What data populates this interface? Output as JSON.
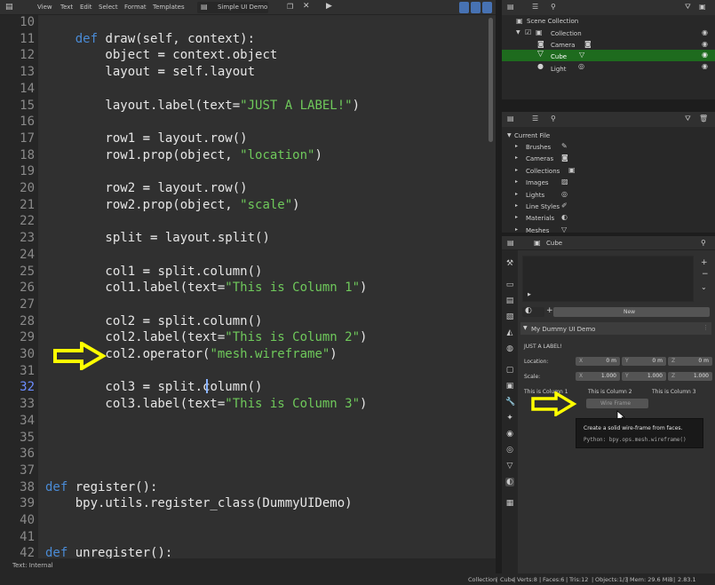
{
  "editor": {
    "menu": [
      "View",
      "Text",
      "Edit",
      "Select",
      "Format",
      "Templates"
    ],
    "file_name": "Simple UI Demo",
    "footer": "Text: Internal",
    "lines": [
      {
        "n": "10",
        "html": ""
      },
      {
        "n": "11",
        "html": "    <span class=\"kw\">def</span> draw(self, context):"
      },
      {
        "n": "12",
        "html": "        object <span class=\"op\">=</span> context.object"
      },
      {
        "n": "13",
        "html": "        layout <span class=\"op\">=</span> self.layout"
      },
      {
        "n": "14",
        "html": ""
      },
      {
        "n": "15",
        "html": "        layout.label(text=<span class=\"st\">\"JUST A LABEL!\"</span>)"
      },
      {
        "n": "16",
        "html": ""
      },
      {
        "n": "17",
        "html": "        row1 <span class=\"op\">=</span> layout.row()"
      },
      {
        "n": "18",
        "html": "        row1.prop(object, <span class=\"st\">\"location\"</span>)"
      },
      {
        "n": "19",
        "html": ""
      },
      {
        "n": "20",
        "html": "        row2 <span class=\"op\">=</span> layout.row()"
      },
      {
        "n": "21",
        "html": "        row2.prop(object, <span class=\"st\">\"scale\"</span>)"
      },
      {
        "n": "22",
        "html": ""
      },
      {
        "n": "23",
        "html": "        split <span class=\"op\">=</span> layout.split()"
      },
      {
        "n": "24",
        "html": ""
      },
      {
        "n": "25",
        "html": "        col1 <span class=\"op\">=</span> split.column()"
      },
      {
        "n": "26",
        "html": "        col1.label(text=<span class=\"st\">\"This is Column 1\"</span>)"
      },
      {
        "n": "27",
        "html": ""
      },
      {
        "n": "28",
        "html": "        col2 <span class=\"op\">=</span> split.column()"
      },
      {
        "n": "29",
        "html": "        col2.label(text=<span class=\"st\">\"This is Column 2\"</span>)"
      },
      {
        "n": "30",
        "html": "        col2.operator(<span class=\"st\">\"mesh.wireframe\"</span>)"
      },
      {
        "n": "31",
        "html": ""
      },
      {
        "n": "32",
        "html": "        col3 <span class=\"op\">=</span> split.column()"
      },
      {
        "n": "33",
        "html": "        col3.label(text=<span class=\"st\">\"This is Column 3\"</span>)"
      },
      {
        "n": "34",
        "html": ""
      },
      {
        "n": "35",
        "html": ""
      },
      {
        "n": "36",
        "html": ""
      },
      {
        "n": "37",
        "html": ""
      },
      {
        "n": "38",
        "html": "<span class=\"kw\">def</span> register():"
      },
      {
        "n": "39",
        "html": "    bpy.utils.register_class(DummyUIDemo)"
      },
      {
        "n": "40",
        "html": ""
      },
      {
        "n": "41",
        "html": ""
      },
      {
        "n": "42",
        "html": "<span class=\"kw\">def</span> unregister():"
      }
    ],
    "current_line": "32"
  },
  "outliner": {
    "root": "Scene Collection",
    "items": [
      {
        "label": "Collection"
      },
      {
        "label": "Camera"
      },
      {
        "label": "Cube"
      },
      {
        "label": "Light"
      }
    ]
  },
  "datablocks": {
    "root": "Current File",
    "items": [
      "Brushes",
      "Cameras",
      "Collections",
      "Images",
      "Lights",
      "Line Styles",
      "Materials",
      "Meshes"
    ]
  },
  "properties": {
    "object_name": "Cube",
    "new_button": "New",
    "panel_title": "My Dummy UI Demo",
    "label": "JUST A LABEL!",
    "location_label": "Location:",
    "scale_label": "Scale:",
    "location": [
      {
        "axis": "X",
        "value": "0 m"
      },
      {
        "axis": "Y",
        "value": "0 m"
      },
      {
        "axis": "Z",
        "value": "0 m"
      }
    ],
    "scale": [
      {
        "axis": "X",
        "value": "1.000"
      },
      {
        "axis": "Y",
        "value": "1.000"
      },
      {
        "axis": "Z",
        "value": "1.000"
      }
    ],
    "columns": [
      "This is Column 1",
      "This is Column 2",
      "This is Column 3"
    ],
    "operator_button": "Wire Frame"
  },
  "tooltip": {
    "title": "Create a solid wire-frame from faces.",
    "python": "Python: bpy.ops.mesh.wireframe()"
  },
  "status": {
    "collection": "Collection",
    "object": "Cube",
    "verts": "Verts:8",
    "faces": "Faces:6",
    "tris": "Tris:12",
    "objects": "Objects:1/3",
    "mem": "Mem: 29.6 MiB",
    "version": "2.83.1"
  },
  "colors": {
    "accent_green": "#1e6b1e",
    "arrow_yellow": "#ffff00",
    "keyword": "#4a8bd6",
    "string": "#6fc95b"
  }
}
